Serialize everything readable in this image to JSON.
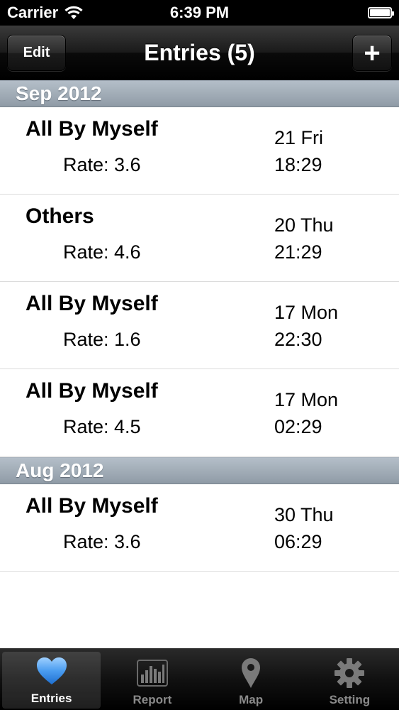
{
  "status_bar": {
    "carrier": "Carrier",
    "time": "6:39 PM"
  },
  "nav": {
    "title": "Entries (5)",
    "edit_label": "Edit",
    "add_label": "+"
  },
  "sections": [
    {
      "header": "Sep 2012",
      "rows": [
        {
          "title": "All By Myself",
          "rate": "Rate: 3.6",
          "date": "21 Fri",
          "time": "18:29"
        },
        {
          "title": "Others",
          "rate": "Rate: 4.6",
          "date": "20 Thu",
          "time": "21:29"
        },
        {
          "title": "All By Myself",
          "rate": "Rate: 1.6",
          "date": "17 Mon",
          "time": "22:30"
        },
        {
          "title": "All By Myself",
          "rate": "Rate: 4.5",
          "date": "17 Mon",
          "time": "02:29"
        }
      ]
    },
    {
      "header": "Aug 2012",
      "rows": [
        {
          "title": "All By Myself",
          "rate": "Rate: 3.6",
          "date": "30 Thu",
          "time": "06:29"
        }
      ]
    }
  ],
  "tabs": [
    {
      "label": "Entries",
      "icon": "heart-icon",
      "active": true
    },
    {
      "label": "Report",
      "icon": "bar-chart-icon",
      "active": false
    },
    {
      "label": "Map",
      "icon": "map-pin-icon",
      "active": false
    },
    {
      "label": "Setting",
      "icon": "gear-icon",
      "active": false
    }
  ],
  "colors": {
    "active_icon": "#3d8ee8",
    "inactive_icon": "#7a7a7a"
  }
}
